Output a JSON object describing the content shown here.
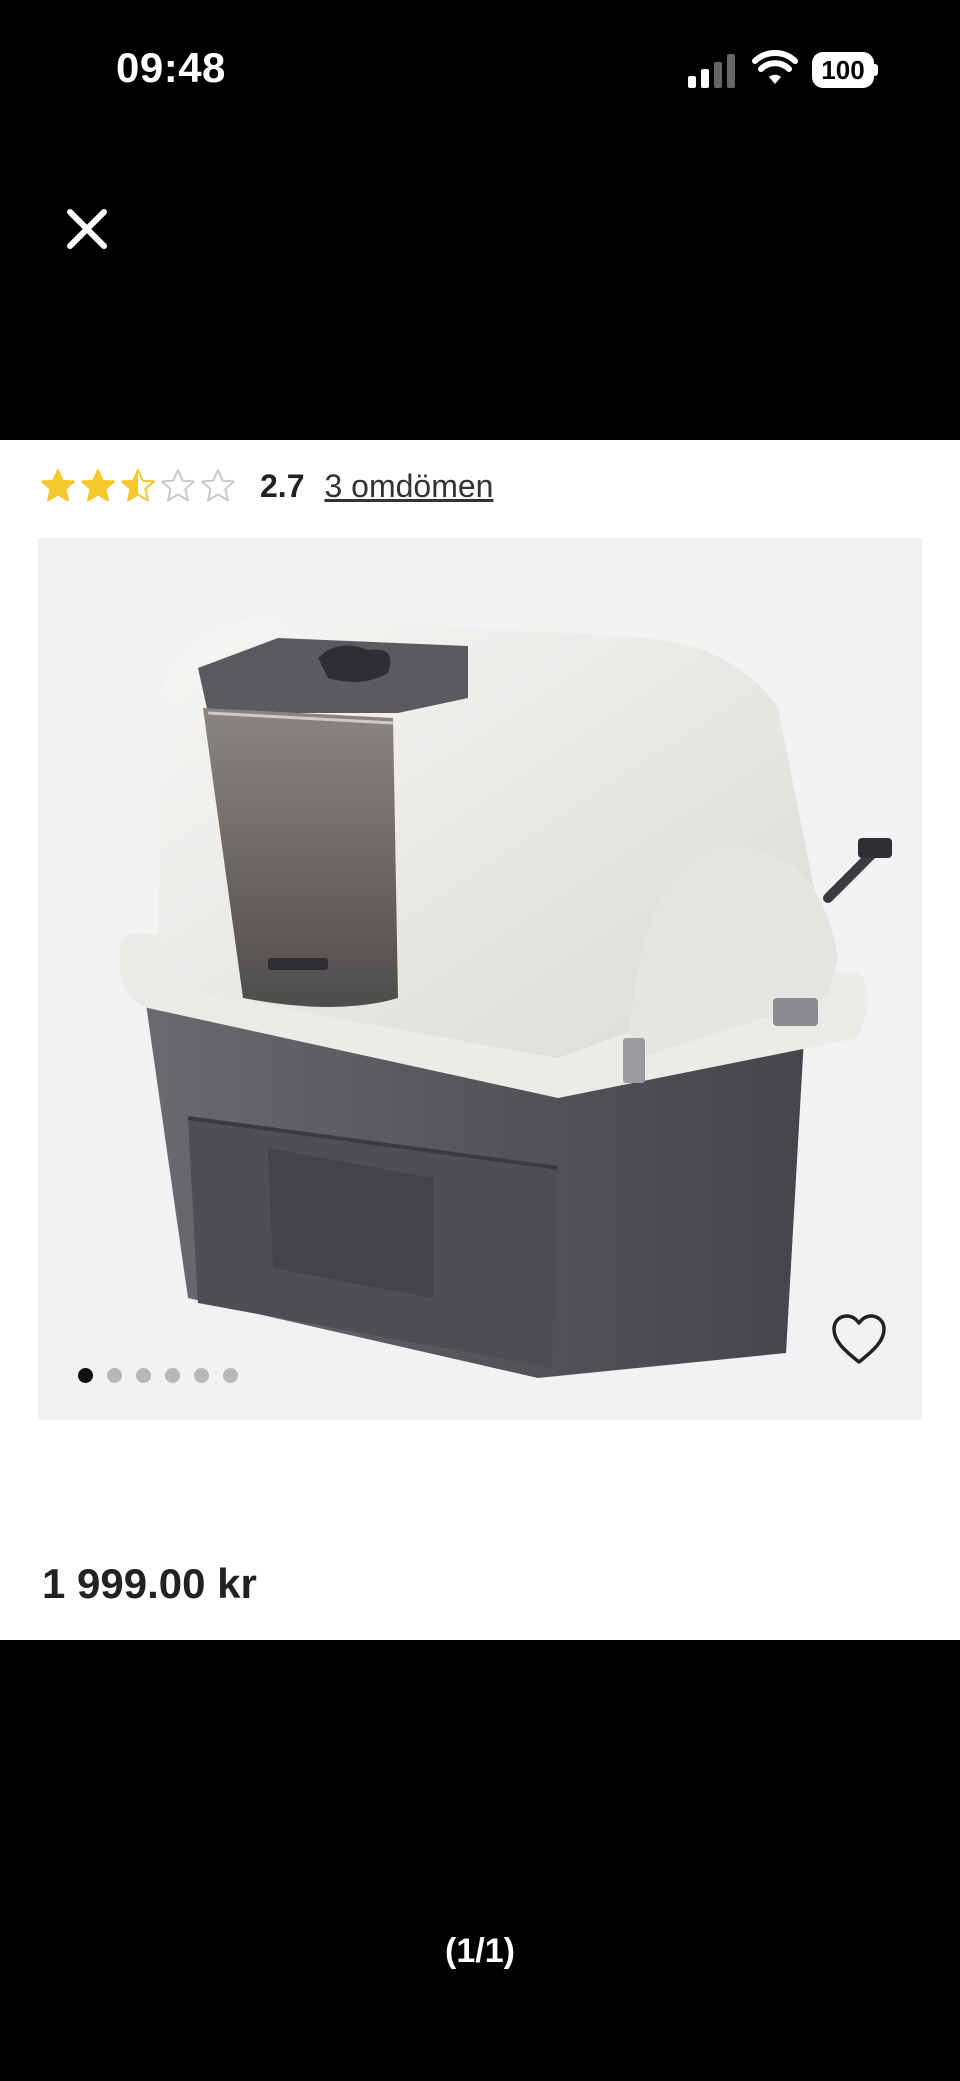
{
  "status_bar": {
    "time": "09:48",
    "battery_level": "100",
    "signal_icon": "cellular-signal-icon",
    "wifi_icon": "wifi-icon"
  },
  "toolbar": {
    "close_icon": "close-icon"
  },
  "product": {
    "rating_value": "2.7",
    "rating_stars": 2.5,
    "rating_max": 5,
    "reviews_label": "3 omdömen",
    "price": "1 999.00 kr",
    "image_count": 6,
    "image_active_index": 0,
    "favorite_icon": "heart-icon"
  },
  "viewer": {
    "pager": "(1/1)"
  },
  "colors": {
    "background": "#000000",
    "sheet": "#ffffff",
    "star_filled": "#f3c92c",
    "star_empty": "#c9c9c9",
    "image_bg": "#f2f2f4"
  }
}
